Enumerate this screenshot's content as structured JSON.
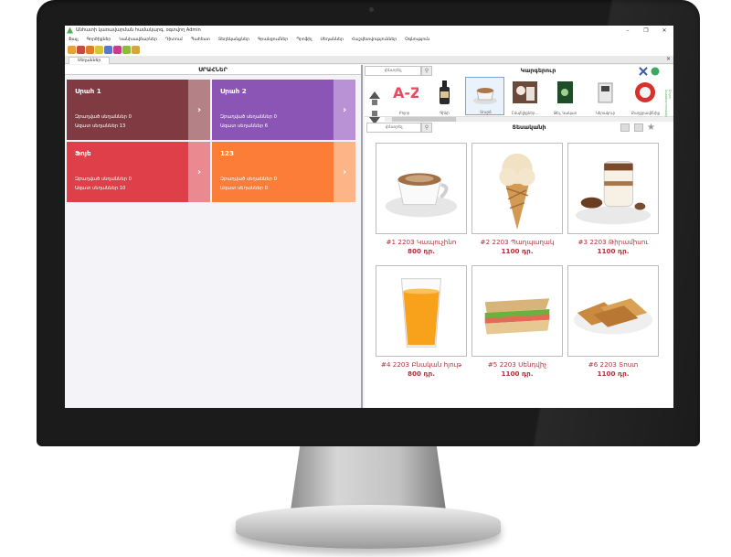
{
  "window": {
    "title": "Անհատի կառավարման համակարգ, օգտվող Admin",
    "min": "–",
    "max": "❐",
    "close": "✕"
  },
  "menu": [
    "Ֆայլ",
    "Գործիքներ",
    "Կանխավճարներ",
    "Դիտում",
    "Պահեստ",
    "Տեղեկանքներ",
    "Գրանցումներ",
    "Պրոֆիլ",
    "Սեղաններ",
    "Հաշվետվություններ",
    "Օգնություն"
  ],
  "tab": {
    "label": "Սեղաններ",
    "close": "×"
  },
  "halls_header": "ՍՐԱՀՆԵՐ",
  "halls": [
    {
      "name": "Սրահ 1",
      "line1": "Զբաղված սեղաններ 0",
      "line2": "Ազատ սեղաններ 13",
      "color": "#7f3b41",
      "arrow_color": "#b48286",
      "arrow": "›"
    },
    {
      "name": "Սրահ 2",
      "line1": "Զբաղված սեղաններ 0",
      "line2": "Ազատ սեղաններ 6",
      "color": "#8b55b5",
      "arrow_color": "#b892d4",
      "arrow": "›"
    },
    {
      "name": "Ֆոյե",
      "line1": "Զբաղված սեղաններ 0",
      "line2": "Ազատ սեղաններ 10",
      "color": "#df3f49",
      "arrow_color": "#ea8a90",
      "arrow": "›"
    },
    {
      "name": "123",
      "line1": "Զբաղված սեղաններ 0",
      "line2": "Ազատ սեղաններ 0",
      "color": "#fb7d38",
      "arrow_color": "#fdb486",
      "arrow": "›"
    }
  ],
  "category_search": {
    "placeholder": "փնտրել",
    "icon": "search-icon"
  },
  "categories_title": "Կարգերուր",
  "categories": [
    {
      "label": "Բոլոր",
      "icon": "az-sort-icon"
    },
    {
      "label": "Գինի",
      "icon": "wine-bottle-icon"
    },
    {
      "label": "Սուրճ",
      "icon": "coffee-cup-icon"
    },
    {
      "label": "Ըմպելիքներ...",
      "icon": "drinks-icon"
    },
    {
      "label": "Թեյ, Կակաո",
      "icon": "tea-icon"
    },
    {
      "label": "Կերակուր",
      "icon": "food-icon"
    },
    {
      "label": "Քաղցրավենիք",
      "icon": "dessert-icon"
    }
  ],
  "vertical_tab": "Բոլոր կատեգորիաներ",
  "product_search": {
    "placeholder": "փնտրել"
  },
  "products_title": "Տեսականի",
  "products": [
    {
      "name": "#1 2203 Կապուչինո",
      "price": "800 դր.",
      "image": "coffee-cup"
    },
    {
      "name": "#2 2203 Պաղպաղակ",
      "price": "1100 դր.",
      "image": "ice-cream-cone"
    },
    {
      "name": "#3 2203 Թիրամիսու",
      "price": "1100 դր.",
      "image": "tiramisu"
    },
    {
      "name": "#4 2203 Բնական հյութ",
      "price": "800 դր.",
      "image": "orange-juice"
    },
    {
      "name": "#5 2203 Սենդվիչ",
      "price": "1100 դր.",
      "image": "sandwich"
    },
    {
      "name": "#6 2203 Տոստ",
      "price": "1100 դր.",
      "image": "toast"
    }
  ]
}
